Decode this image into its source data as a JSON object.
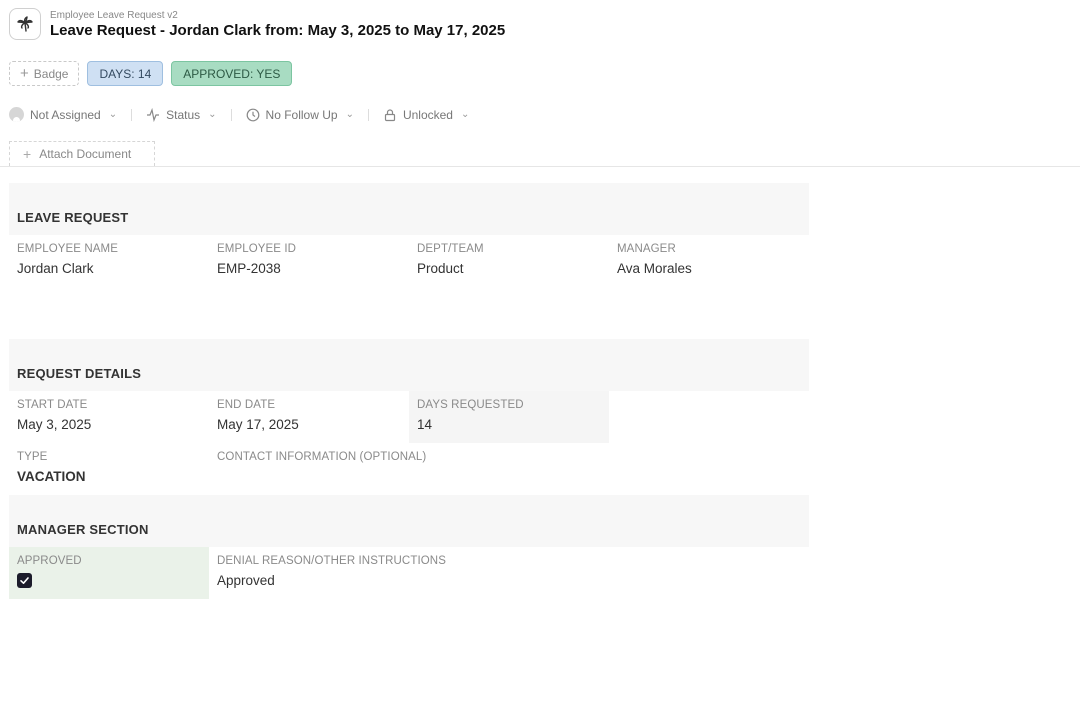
{
  "header": {
    "form_name": "Employee Leave Request v2",
    "title": "Leave Request - Jordan Clark from: May 3, 2025 to May 17, 2025",
    "icon": "palm-tree-icon"
  },
  "badges": {
    "add_label": "Badge",
    "days": "DAYS: 14",
    "approved": "APPROVED: YES"
  },
  "toolbar": {
    "assignee": "Not Assigned",
    "status": "Status",
    "follow_up": "No Follow Up",
    "lock": "Unlocked"
  },
  "attach_label": "Attach Document",
  "sections": {
    "leave_request": {
      "title": "LEAVE REQUEST",
      "employee_name": {
        "label": "EMPLOYEE NAME",
        "value": "Jordan Clark"
      },
      "employee_id": {
        "label": "EMPLOYEE ID",
        "value": "EMP-2038"
      },
      "dept_team": {
        "label": "DEPT/TEAM",
        "value": "Product"
      },
      "manager": {
        "label": "MANAGER",
        "value": "Ava Morales"
      }
    },
    "request_details": {
      "title": "REQUEST DETAILS",
      "start_date": {
        "label": "START DATE",
        "value": "May 3, 2025"
      },
      "end_date": {
        "label": "END DATE",
        "value": "May 17, 2025"
      },
      "days_requested": {
        "label": "DAYS REQUESTED",
        "value": "14"
      },
      "type": {
        "label": "TYPE",
        "value": "VACATION"
      },
      "contact": {
        "label": "CONTACT INFORMATION (OPTIONAL)",
        "value": ""
      }
    },
    "manager_section": {
      "title": "MANAGER SECTION",
      "approved": {
        "label": "APPROVED",
        "checked": true
      },
      "denial_reason": {
        "label": "DENIAL REASON/OTHER INSTRUCTIONS",
        "value": "Approved"
      }
    }
  },
  "colors": {
    "days_badge": "#cfe0f3",
    "approved_badge": "#a8dcc2",
    "approved_cell": "#eaf2e9",
    "checkbox": "#1c1c2b"
  }
}
